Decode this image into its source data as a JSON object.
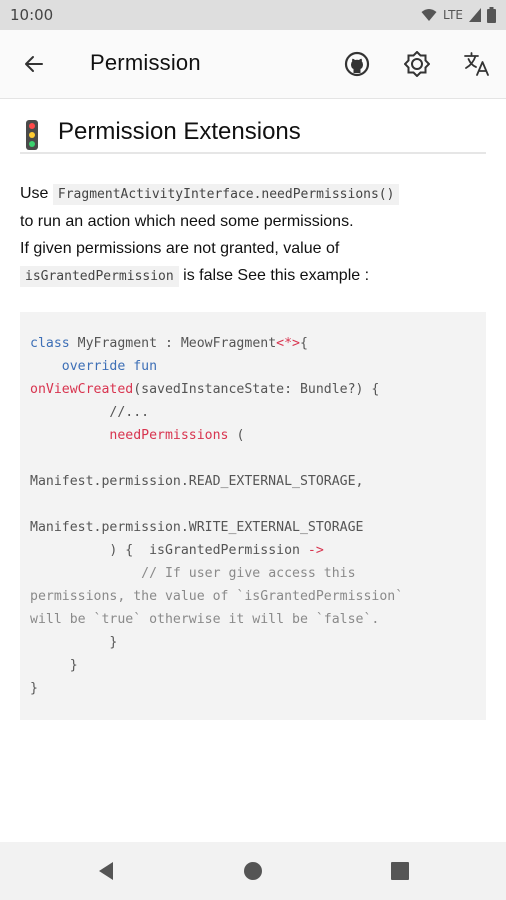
{
  "status_bar": {
    "time": "10:00",
    "network": "LTE"
  },
  "app_bar": {
    "title": "Permission"
  },
  "section": {
    "title": "Permission Extensions"
  },
  "body": {
    "line1_prefix": "Use",
    "inline_code_1": "FragmentActivityInterface.needPermissions()",
    "line2": "to run an action which need some permissions.",
    "line3": "If given permissions are not granted, value of",
    "inline_code_2": "isGrantedPermission",
    "line4_suffix": "is false See this example :"
  },
  "code": {
    "l1a": "class",
    "l1b": " MyFragment : MeowFragment",
    "l1c": "<*>",
    "l1d": "{",
    "l2": "override fun",
    "l3a": "onViewCreated",
    "l3b": "(savedInstanceState: Bundle?) {",
    "l4": "//...",
    "l5a": "needPermissions",
    "l5b": " (",
    "l7": "Manifest.permission.READ_EXTERNAL_STORAGE,",
    "l9": "Manifest.permission.WRITE_EXTERNAL_STORAGE",
    "l10a": ") {  isGrantedPermission ",
    "l10b": "->",
    "l11": "// If user give access this",
    "l12": "permissions, the value of `isGrantedPermission`",
    "l13": "will be `true` otherwise it will be `false`.",
    "l14": "}",
    "l15": "}",
    "l16": "}"
  },
  "icons": {
    "back": "arrow-back-icon",
    "github": "github-icon",
    "theme": "brightness-icon",
    "translate": "translate-icon"
  }
}
